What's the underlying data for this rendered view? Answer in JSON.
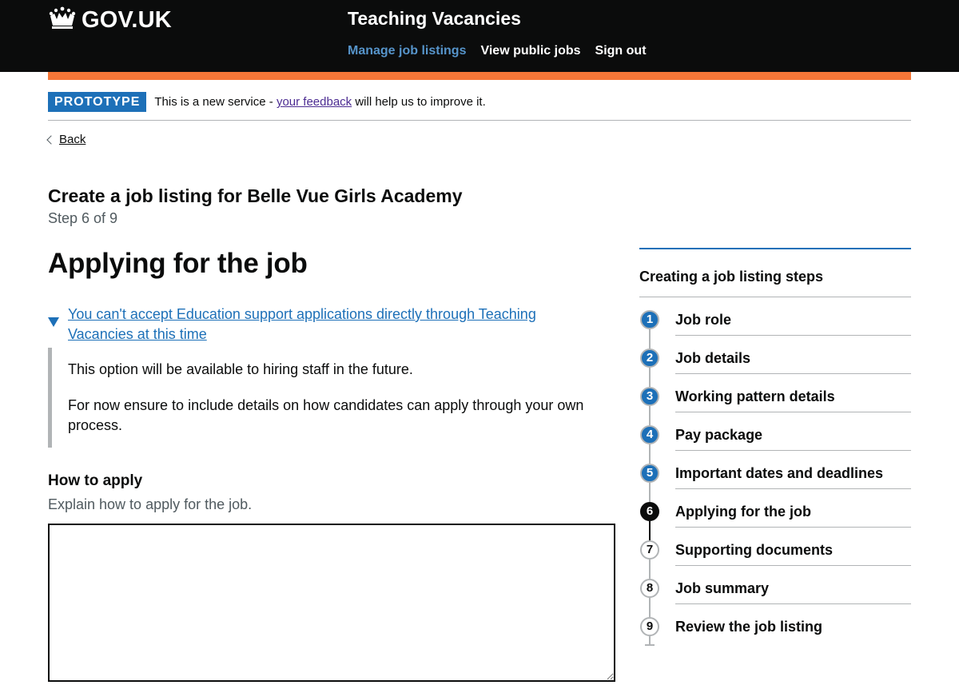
{
  "header": {
    "logo_text": "GOV.UK",
    "service_name": "Teaching Vacancies",
    "nav": [
      {
        "label": "Manage job listings",
        "active": true
      },
      {
        "label": "View public jobs",
        "active": false
      },
      {
        "label": "Sign out",
        "active": false
      }
    ]
  },
  "phase_banner": {
    "tag": "PROTOTYPE",
    "text_before": "This is a new service -",
    "link": "your feedback",
    "text_after": "will help us to improve it."
  },
  "back_link": "Back",
  "caption": {
    "title": "Create a job listing for Belle Vue Girls Academy",
    "step": "Step 6 of 9"
  },
  "page_title": "Applying for the job",
  "details": {
    "summary": "You can't accept Education support applications directly through Teaching Vacancies at this time",
    "paragraph1": "This option will be available to hiring staff in the future.",
    "paragraph2": "For now ensure to include details on how candidates can apply through your own process."
  },
  "form": {
    "label": "How to apply",
    "hint": "Explain how to apply for the job.",
    "value": ""
  },
  "sidebar": {
    "title": "Creating a job listing steps",
    "steps": [
      {
        "number": "1",
        "label": "Job role",
        "status": "done"
      },
      {
        "number": "2",
        "label": "Job details",
        "status": "done"
      },
      {
        "number": "3",
        "label": "Working pattern details",
        "status": "done"
      },
      {
        "number": "4",
        "label": "Pay package",
        "status": "done"
      },
      {
        "number": "5",
        "label": "Important dates and deadlines",
        "status": "done"
      },
      {
        "number": "6",
        "label": "Applying for the job",
        "status": "current"
      },
      {
        "number": "7",
        "label": "Supporting documents",
        "status": "todo"
      },
      {
        "number": "8",
        "label": "Job summary",
        "status": "todo"
      },
      {
        "number": "9",
        "label": "Review the job listing",
        "status": "todo"
      }
    ]
  },
  "colors": {
    "header_bg": "#0b0c0c",
    "accent_orange": "#f47738",
    "link_blue": "#1d70b8",
    "visited_purple": "#4c2c92"
  },
  "icons": {
    "logo": "crown-icon",
    "back": "chevron-left-icon",
    "details": "triangle-down-icon"
  }
}
